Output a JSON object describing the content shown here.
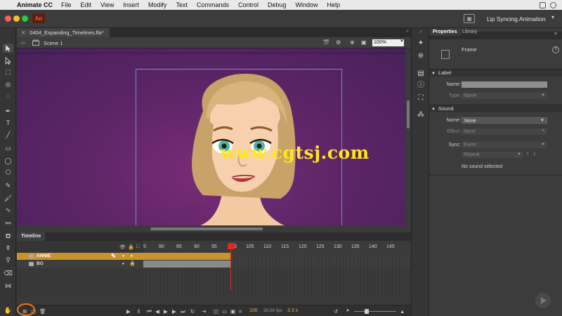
{
  "menubar": {
    "app_name": "Animate CC",
    "items": [
      "File",
      "Edit",
      "View",
      "Insert",
      "Modify",
      "Text",
      "Commands",
      "Control",
      "Debug",
      "Window",
      "Help"
    ]
  },
  "titlebar": {
    "app_logo": "An",
    "workspace_name": "Lip Syncing Animation"
  },
  "document": {
    "tab_name": "0404_Expanding_Timelines.fla*",
    "scene_label": "Scene 1",
    "zoom": "100%"
  },
  "watermark": "www.cgtsj.com",
  "timeline": {
    "tab_label": "Timeline",
    "ruler_ticks": [
      "5",
      "80",
      "85",
      "90",
      "95",
      "100",
      "105",
      "110",
      "115",
      "120",
      "125",
      "130",
      "135",
      "140",
      "145"
    ],
    "layers": [
      {
        "name": "ANNIE",
        "selected": true
      },
      {
        "name": "BG",
        "selected": false
      }
    ],
    "current_frame": "100",
    "fps": "30.00 fps",
    "elapsed": "3.3 s"
  },
  "properties": {
    "tabs": [
      "Properties",
      "Library"
    ],
    "frame_label": "Frame",
    "label_section": {
      "title": "Label",
      "name_label": "Name:",
      "name_value": "",
      "type_label": "Type:",
      "type_value": "Name"
    },
    "sound_section": {
      "title": "Sound",
      "name_label": "Name:",
      "name_value": "None",
      "effect_label": "Effect:",
      "effect_value": "None",
      "sync_label": "Sync:",
      "sync_value": "Event",
      "repeat_value": "Repeat",
      "repeat_count": "1",
      "status": "No sound selected"
    }
  },
  "colors": {
    "accent_layer": "#c8932a",
    "playhead": "#e0281e",
    "stage_bg": "#5e2567",
    "watermark": "#ffe81a"
  }
}
